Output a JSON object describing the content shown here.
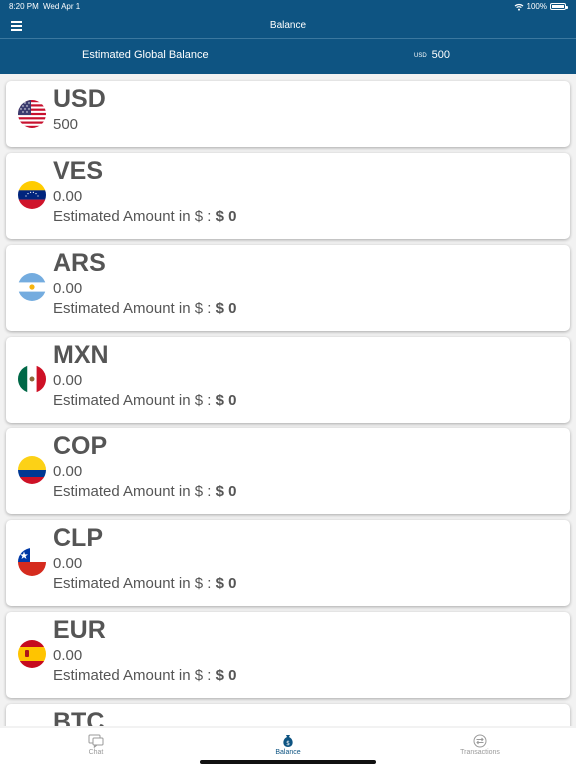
{
  "status": {
    "time": "8:20 PM",
    "date": "Wed Apr 1",
    "battery": "100%"
  },
  "header": {
    "title": "Balance"
  },
  "global": {
    "label": "Estimated Global Balance",
    "currency": "USD",
    "value": "500"
  },
  "estimate_prefix": "Estimated Amount in $ :",
  "accounts": [
    {
      "code": "USD",
      "amount": "500",
      "flag": "us-flag-icon"
    },
    {
      "code": "VES",
      "amount": "0.00",
      "estimate": "$ 0",
      "flag": "venezuela-flag-icon"
    },
    {
      "code": "ARS",
      "amount": "0.00",
      "estimate": "$ 0",
      "flag": "argentina-flag-icon"
    },
    {
      "code": "MXN",
      "amount": "0.00",
      "estimate": "$ 0",
      "flag": "mexico-flag-icon"
    },
    {
      "code": "COP",
      "amount": "0.00",
      "estimate": "$ 0",
      "flag": "colombia-flag-icon"
    },
    {
      "code": "CLP",
      "amount": "0.00",
      "estimate": "$ 0",
      "flag": "chile-flag-icon"
    },
    {
      "code": "EUR",
      "amount": "0.00",
      "estimate": "$ 0",
      "flag": "spain-flag-icon"
    },
    {
      "code": "BTC"
    }
  ],
  "tabs": [
    {
      "label": "Chat",
      "icon": "chat-icon"
    },
    {
      "label": "Balance",
      "icon": "money-bag-icon",
      "active": true
    },
    {
      "label": "Transactions",
      "icon": "transactions-icon"
    }
  ],
  "colors": {
    "header": "#0e5482",
    "text": "#555555",
    "inactive_tab": "#9a9a9a"
  }
}
